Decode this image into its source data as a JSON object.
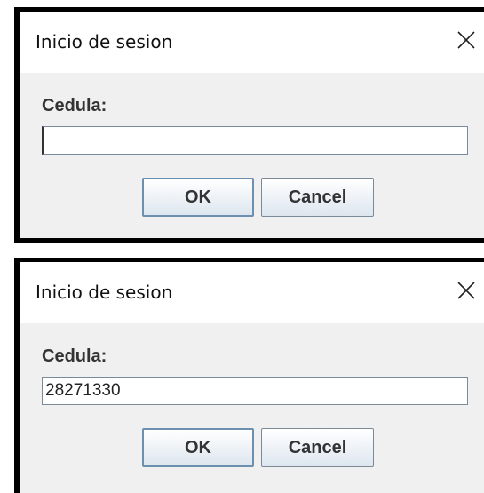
{
  "dialogs": [
    {
      "title": "Inicio de sesion",
      "label": "Cedula:",
      "input_value": "",
      "ok_label": "OK",
      "cancel_label": "Cancel"
    },
    {
      "title": "Inicio de sesion",
      "label": "Cedula:",
      "input_value": "28271330",
      "ok_label": "OK",
      "cancel_label": "Cancel"
    }
  ],
  "icons": {
    "close": "close-icon"
  },
  "colors": {
    "dialog_bg": "#f0f0f0",
    "titlebar_bg": "#ffffff",
    "button_border": "#7a8a99",
    "focus_border": "#6d8fb0"
  }
}
